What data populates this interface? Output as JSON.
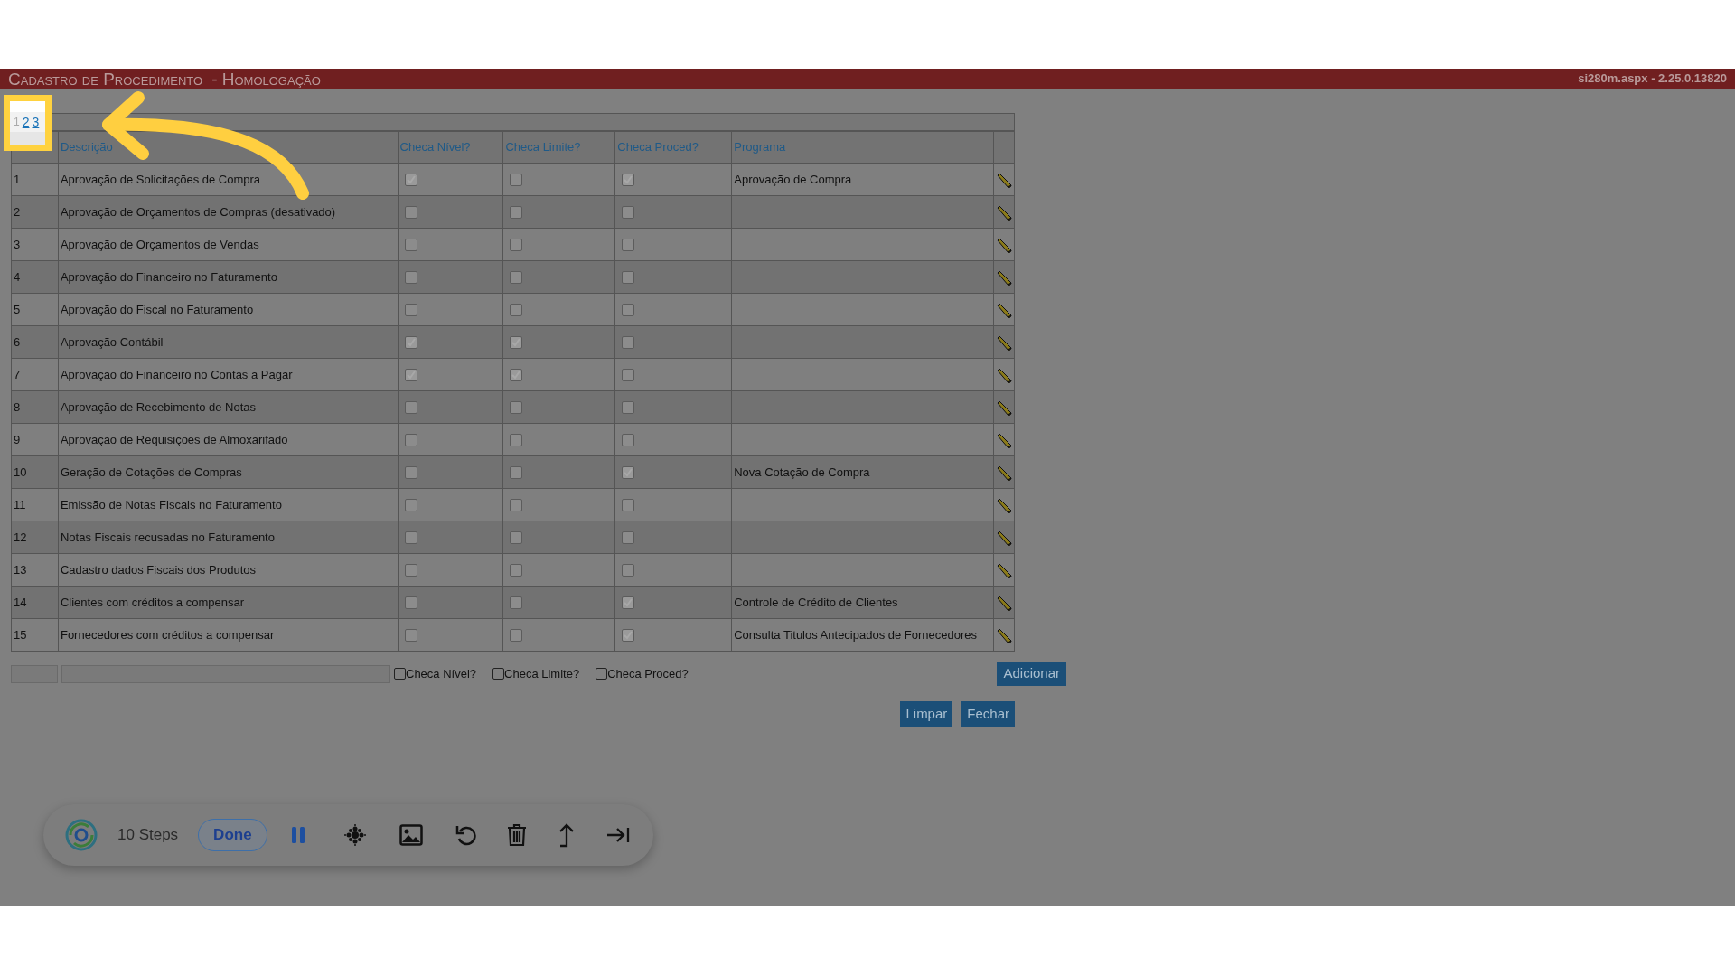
{
  "window": {
    "title": "Cadastro de Procedimento",
    "subtitle": "- Homologação",
    "version": "si280m.aspx - 2.25.0.13820"
  },
  "pagination": [
    {
      "label": "1",
      "selected": true
    },
    {
      "label": "2",
      "selected": false
    },
    {
      "label": "3",
      "selected": false
    }
  ],
  "table": {
    "columns": [
      "Descrição",
      "Checa Nível?",
      "Checa Limite?",
      "Checa Proced?",
      "Programa"
    ],
    "rows": [
      {
        "code": "1",
        "description": "Aprovação de Solicitações de Compra",
        "nivel": true,
        "limite": false,
        "proced": true,
        "programa": "Aprovação de Compra"
      },
      {
        "code": "2",
        "description": "Aprovação de Orçamentos de Compras (desativado)",
        "nivel": false,
        "limite": false,
        "proced": false
      },
      {
        "code": "3",
        "description": "Aprovação de Orçamentos de Vendas",
        "nivel": false,
        "limite": false,
        "proced": false
      },
      {
        "code": "4",
        "description": "Aprovação do Financeiro no Faturamento",
        "nivel": false,
        "limite": false,
        "proced": false
      },
      {
        "code": "5",
        "description": "Aprovação do Fiscal no Faturamento",
        "nivel": false,
        "limite": false,
        "proced": false
      },
      {
        "code": "6",
        "description": "Aprovação Contábil",
        "nivel": true,
        "limite": true,
        "proced": false
      },
      {
        "code": "7",
        "description": "Aprovação do Financeiro no Contas a Pagar",
        "nivel": true,
        "limite": true,
        "proced": false
      },
      {
        "code": "8",
        "description": "Aprovação de Recebimento de Notas",
        "nivel": false,
        "limite": false,
        "proced": false
      },
      {
        "code": "9",
        "description": "Aprovação de Requisições de Almoxarifado",
        "nivel": false,
        "limite": false,
        "proced": false
      },
      {
        "code": "10",
        "description": "Geração de Cotações de Compras",
        "nivel": false,
        "limite": false,
        "proced": true,
        "programa": "Nova Cotação de Compra"
      },
      {
        "code": "11",
        "description": "Emissão de Notas Fiscais no Faturamento",
        "nivel": false,
        "limite": false,
        "proced": false
      },
      {
        "code": "12",
        "description": "Notas Fiscais recusadas no Faturamento",
        "nivel": false,
        "limite": false,
        "proced": false
      },
      {
        "code": "13",
        "description": "Cadastro dados Fiscais dos Produtos",
        "nivel": false,
        "limite": false,
        "proced": false
      },
      {
        "code": "14",
        "description": "Clientes com créditos a compensar",
        "nivel": false,
        "limite": false,
        "proced": true,
        "programa": "Controle de Crédito de Clientes"
      },
      {
        "code": "15",
        "description": "Fornecedores com créditos a compensar",
        "nivel": false,
        "limite": false,
        "proced": true,
        "programa": "Consulta Titulos Antecipados de Fornecedores"
      }
    ]
  },
  "form": {
    "checks": [
      {
        "label": "Checa Nível?",
        "checked": false
      },
      {
        "label": "Checa Limite?",
        "checked": false
      },
      {
        "label": "Checa Proced?",
        "checked": false
      }
    ],
    "add_button": "Adicionar"
  },
  "buttons": [
    "Limpar",
    "Fechar"
  ],
  "recorder": {
    "steps": "10 Steps",
    "done": "Done"
  }
}
